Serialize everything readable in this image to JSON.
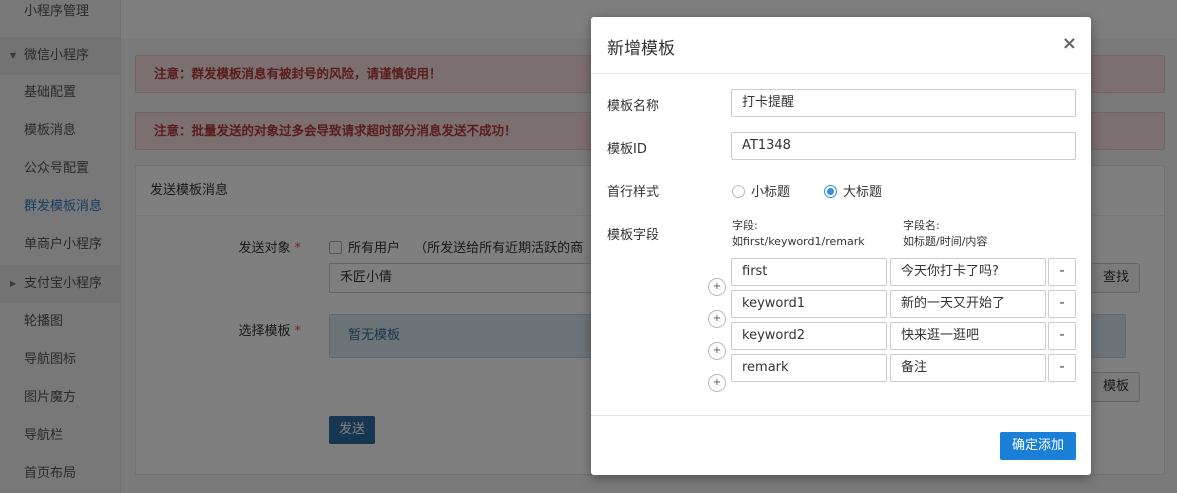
{
  "sidebar": {
    "top_item": "小程序管理",
    "groups": [
      {
        "label": "微信小程序",
        "expanded": true
      },
      {
        "label": "支付宝小程序",
        "expanded": false
      }
    ],
    "wechat_items": [
      "基础配置",
      "模板消息",
      "公众号配置",
      "群发模板消息",
      "单商户小程序"
    ],
    "alipay_items": [
      "轮播图",
      "导航图标",
      "图片魔方",
      "导航栏",
      "首页布局"
    ],
    "active_item": "群发模板消息"
  },
  "main": {
    "alerts": [
      "注意：群发模板消息有被封号的风险，请谨慎使用！",
      "注意：批量发送的对象过多会导致请求超时部分消息发送不成功！"
    ],
    "panel_title": "发送模板消息",
    "send_target_label": "发送对象",
    "all_users_label": "所有用户",
    "all_users_note": "（所发送给所有近期活跃的商",
    "user_search_value": "禾匠小倩",
    "search_button": "查找",
    "select_template_label": "选择模板",
    "no_template_text": "暂无模板",
    "template_button": "模板",
    "send_button": "发送"
  },
  "modal": {
    "title": "新增模板",
    "close_symbol": "×",
    "name_label": "模板名称",
    "name_value": "打卡提醒",
    "id_label": "模板ID",
    "id_value": "AT1348",
    "style_label": "首行样式",
    "style_options": [
      {
        "label": "小标题",
        "selected": false
      },
      {
        "label": "大标题",
        "selected": true
      }
    ],
    "fields_label": "模板字段",
    "field_hint_line1": "字段:",
    "field_hint_line2": "如first/keyword1/remark",
    "name_hint_line1": "字段名:",
    "name_hint_line2": "如标题/时间/内容",
    "fields": [
      {
        "key": "first",
        "name": "今天你打卡了吗?"
      },
      {
        "key": "keyword1",
        "name": "新的一天又开始了"
      },
      {
        "key": "keyword2",
        "name": "快来逛一逛吧"
      },
      {
        "key": "remark",
        "name": "备注"
      }
    ],
    "plus_symbol": "+",
    "minus_symbol": "-",
    "confirm_button": "确定添加"
  }
}
